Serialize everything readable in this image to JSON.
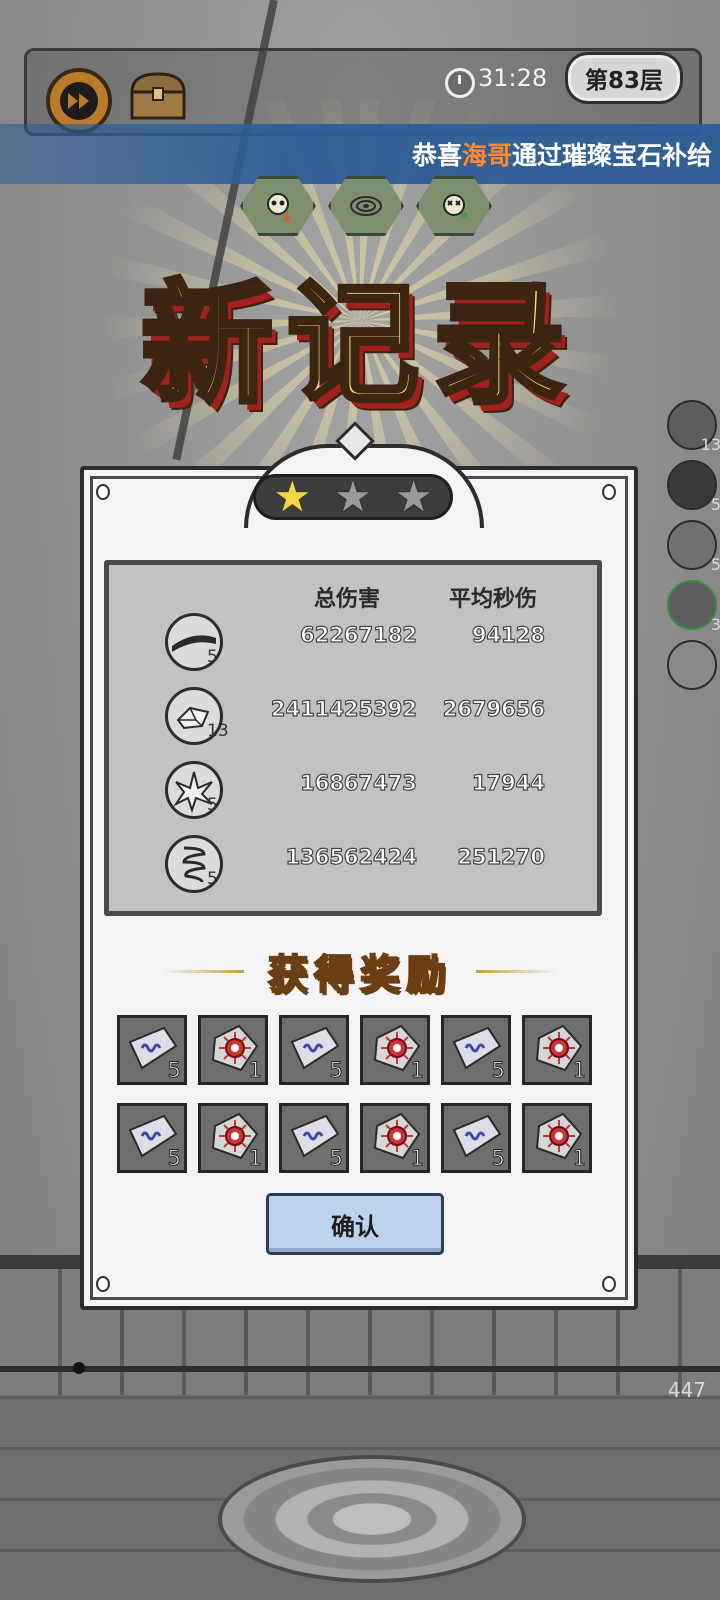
{
  "hud": {
    "fast_forward_icon": "fast-forward-icon",
    "chest_icon": "treasure-chest-icon",
    "timer": "31:28",
    "floor_label": "第83层"
  },
  "announcement": {
    "prefix": "恭喜",
    "player": "海哥",
    "suffix": "通过璀璨宝石补给",
    "player_color": "#ff8a2b"
  },
  "buffs": [
    "skull-attack-up-icon",
    "target-icon",
    "skull-heal-icon"
  ],
  "side_skills": [
    {
      "icon": "crystal-shard-icon",
      "level": "13"
    },
    {
      "icon": "dark-orb-icon",
      "level": "5"
    },
    {
      "icon": "spiral-icon",
      "level": "5"
    },
    {
      "icon": "blade-icon",
      "level": "3"
    },
    {
      "icon": "empty-slot-icon",
      "level": ""
    }
  ],
  "title": "新记录",
  "stars": {
    "earned": 1,
    "total": 3
  },
  "stats": {
    "headers": {
      "total_damage": "总伤害",
      "avg_dps": "平均秒伤"
    },
    "rows": [
      {
        "icon": "blade-icon",
        "level": "5",
        "total": "62267182",
        "dps": "94128"
      },
      {
        "icon": "crystal-shard-icon",
        "level": "13",
        "total": "2411425392",
        "dps": "2679656"
      },
      {
        "icon": "ice-crystal-icon",
        "level": "5",
        "total": "16867473",
        "dps": "17944"
      },
      {
        "icon": "whirlwind-icon",
        "level": "5",
        "total": "136562424",
        "dps": "251270"
      }
    ]
  },
  "rewards_title": "获得奖励",
  "rewards": [
    {
      "icon": "rune-stone-icon",
      "count": "5"
    },
    {
      "icon": "red-gem-stone-icon",
      "count": "1"
    },
    {
      "icon": "rune-stone-icon",
      "count": "5"
    },
    {
      "icon": "red-gem-stone-icon",
      "count": "1"
    },
    {
      "icon": "rune-stone-icon",
      "count": "5"
    },
    {
      "icon": "red-gem-stone-icon",
      "count": "1"
    },
    {
      "icon": "rune-stone-icon",
      "count": "5"
    },
    {
      "icon": "red-gem-stone-icon",
      "count": "1"
    },
    {
      "icon": "rune-stone-icon",
      "count": "5"
    },
    {
      "icon": "red-gem-stone-icon",
      "count": "1"
    },
    {
      "icon": "rune-stone-icon",
      "count": "5"
    },
    {
      "icon": "red-gem-stone-icon",
      "count": "1"
    }
  ],
  "confirm_label": "确认",
  "progress": {
    "value": 0.11,
    "score": "447"
  }
}
